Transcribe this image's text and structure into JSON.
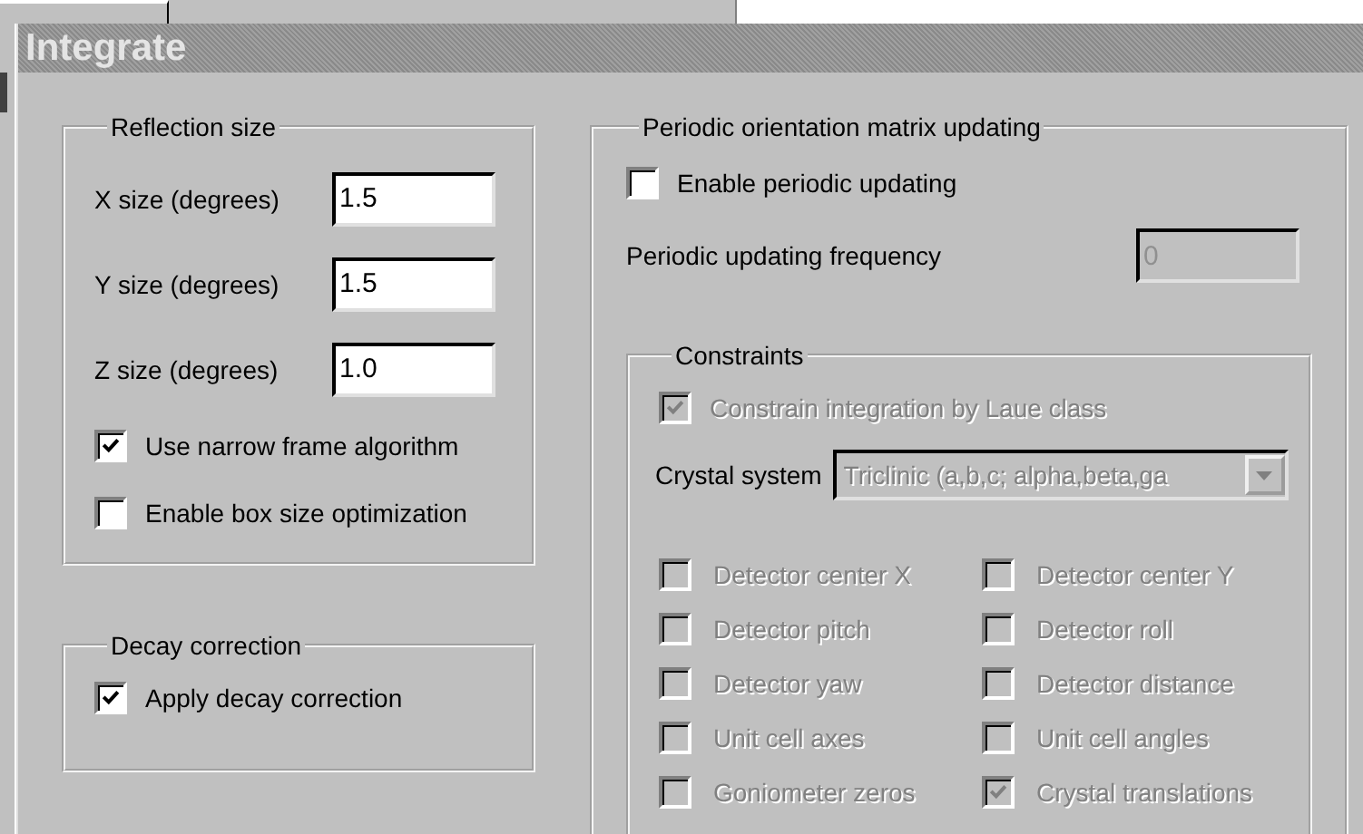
{
  "window": {
    "title": "Integrate"
  },
  "reflection_size": {
    "title": "Reflection size",
    "fields": [
      {
        "label": "X size (degrees)",
        "value": "1.5"
      },
      {
        "label": "Y size (degrees)",
        "value": "1.5"
      },
      {
        "label": "Z size (degrees)",
        "value": "1.0"
      }
    ],
    "options": [
      {
        "label": "Use narrow frame algorithm",
        "checked": true
      },
      {
        "label": "Enable box size optimization",
        "checked": false
      }
    ]
  },
  "decay_correction": {
    "title": "Decay correction",
    "options": [
      {
        "label": "Apply decay correction",
        "checked": true
      }
    ]
  },
  "periodic_updating": {
    "title": "Periodic orientation matrix updating",
    "enable": {
      "label": "Enable periodic updating",
      "checked": false
    },
    "frequency": {
      "label": "Periodic updating frequency",
      "value": "0",
      "disabled": true
    },
    "constraints": {
      "title": "Constraints",
      "laue": {
        "label": "Constrain integration by Laue class",
        "checked": true,
        "disabled": true
      },
      "crystal_system": {
        "label": "Crystal system",
        "value": "Triclinic (a,b,c; alpha,beta,ga",
        "disabled": true
      },
      "items": [
        {
          "label": "Detector center X",
          "checked": false,
          "disabled": true
        },
        {
          "label": "Detector center Y",
          "checked": false,
          "disabled": true
        },
        {
          "label": "Detector pitch",
          "checked": false,
          "disabled": true
        },
        {
          "label": "Detector roll",
          "checked": false,
          "disabled": true
        },
        {
          "label": "Detector yaw",
          "checked": false,
          "disabled": true
        },
        {
          "label": "Detector distance",
          "checked": false,
          "disabled": true
        },
        {
          "label": "Unit cell axes",
          "checked": false,
          "disabled": true
        },
        {
          "label": "Unit cell angles",
          "checked": false,
          "disabled": true
        },
        {
          "label": "Goniometer zeros",
          "checked": false,
          "disabled": true
        },
        {
          "label": "Crystal translations",
          "checked": true,
          "disabled": true
        }
      ]
    }
  }
}
